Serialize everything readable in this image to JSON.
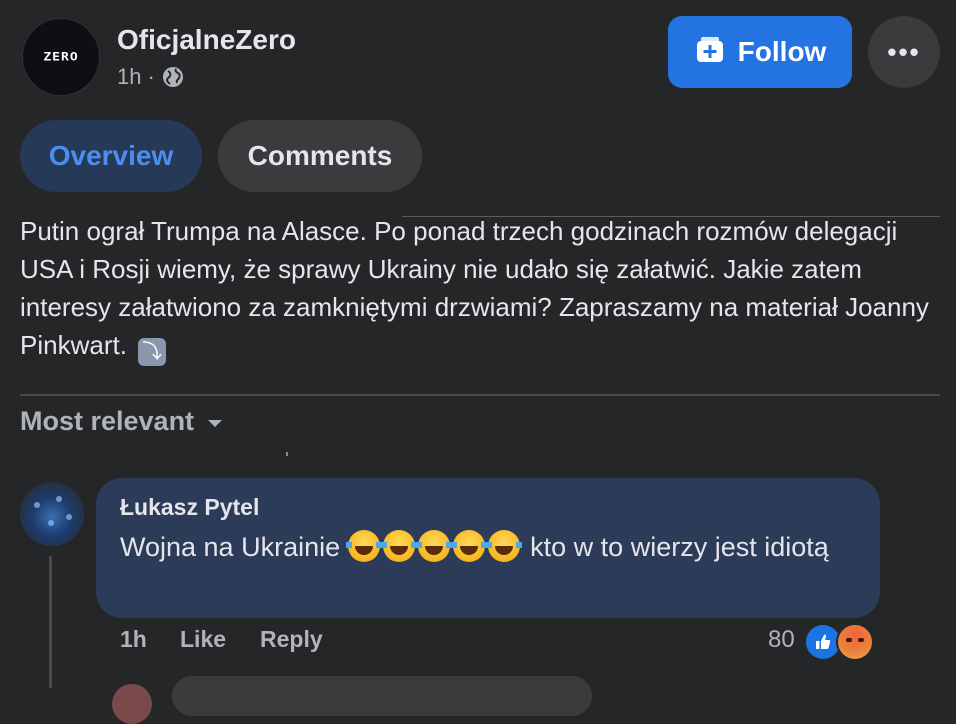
{
  "header": {
    "page_name": "OficjalneZero",
    "logo_text": "ZERO",
    "time": "1h",
    "separator": "·",
    "follow_label": "Follow",
    "more_label": "•••"
  },
  "tabs": [
    {
      "label": "Overview",
      "active": true
    },
    {
      "label": "Comments",
      "active": false
    }
  ],
  "post": {
    "text": "Putin ograł Trumpa na Alasce. Po ponad trzech godzinach rozmów delegacji USA i Rosji wiemy, że sprawy Ukrainy nie udało się załatwić. Jakie zatem interesy załatwiono za zamkniętymi drzwiami? Zapraszamy na materiał Joanny Pinkwart.",
    "trailing_emoji": "⤵"
  },
  "comments_section": {
    "sort_label": "Most relevant"
  },
  "comment": {
    "author": "Łukasz Pytel",
    "text_before": "Wojna na Ukrainie",
    "emoji_count": 5,
    "text_after": "kto w to wierzy jest idiotą",
    "time": "1h",
    "like_label": "Like",
    "reply_label": "Reply",
    "reaction_count": "80",
    "reactions": [
      "like",
      "angry"
    ]
  },
  "colors": {
    "background": "#252628",
    "accent": "#2374e1",
    "bubble": "#2c3b58",
    "active_tab_bg": "#263a57",
    "active_tab_text": "#4b8ef0"
  }
}
